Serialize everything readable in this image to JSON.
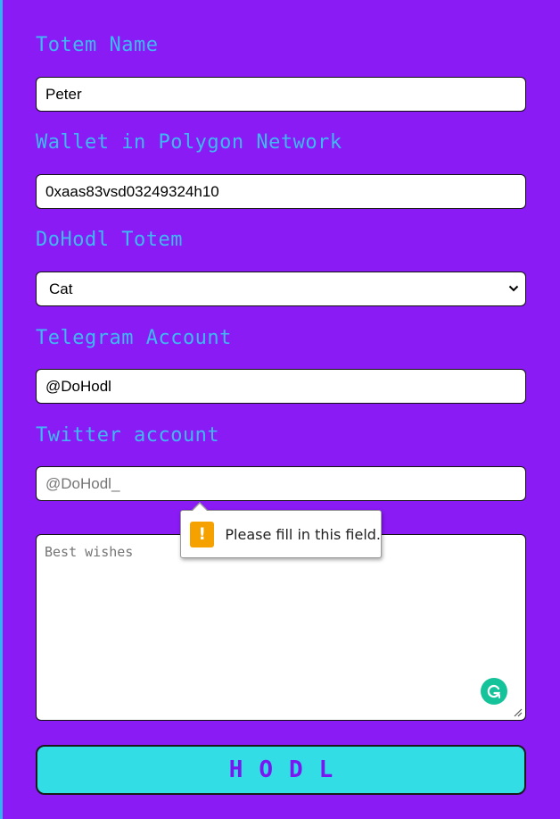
{
  "form": {
    "totem_name": {
      "label": "Totem Name",
      "value": "Peter"
    },
    "wallet": {
      "label": "Wallet in Polygon Network",
      "value": "0xaas83vsd03249324h10"
    },
    "totem": {
      "label": "DoHodl Totem",
      "selected": "Cat"
    },
    "telegram": {
      "label": "Telegram Account",
      "value": "@DoHodl"
    },
    "twitter": {
      "label": "Twitter account",
      "placeholder": "@DoHodl_"
    },
    "message": {
      "placeholder": "Best wishes"
    },
    "submit_label": "HODL"
  },
  "validation": {
    "message": "Please fill in this field.",
    "icon": "warning-icon"
  },
  "colors": {
    "background": "#8a1bf5",
    "label": "#3fb9f2",
    "button": "#33dde6",
    "button_text": "#7a17f0",
    "warning": "#f5a200",
    "grammarly": "#15c39a"
  }
}
